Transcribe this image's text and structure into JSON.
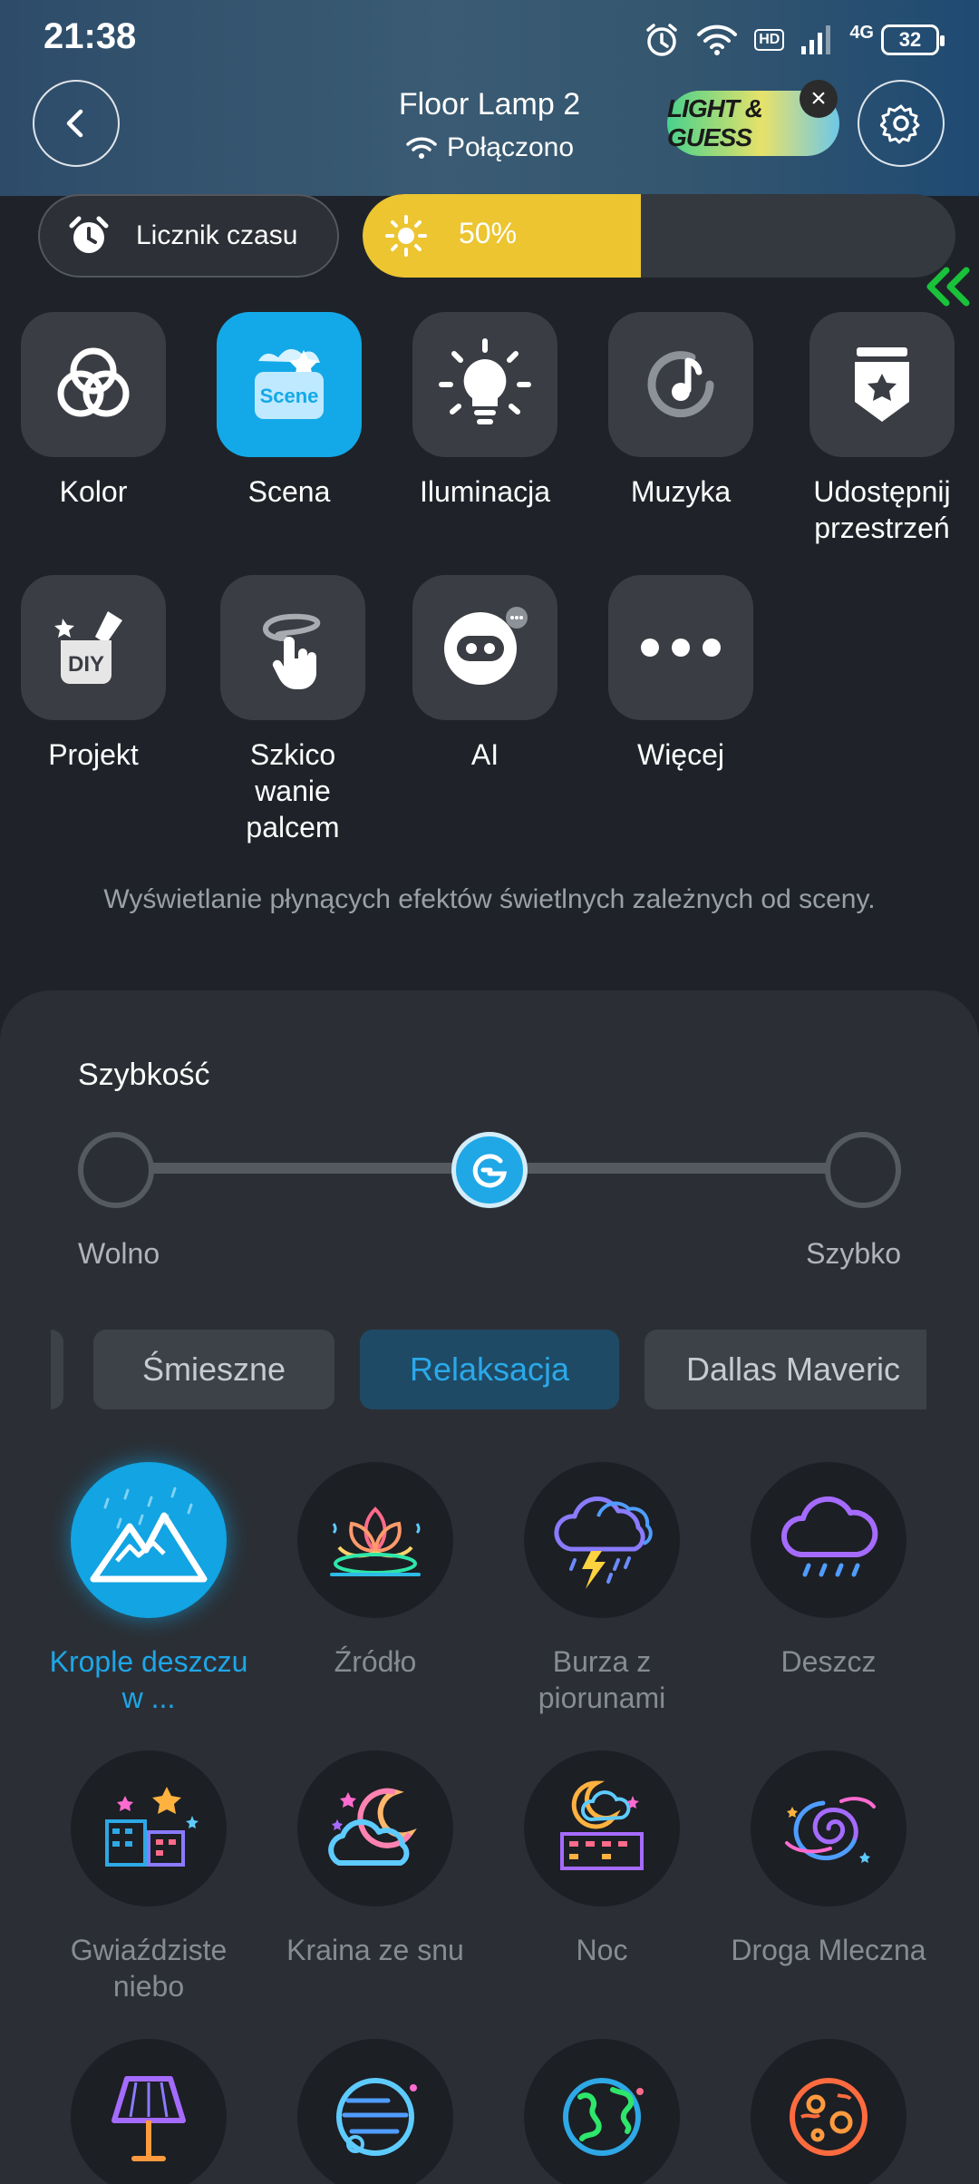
{
  "status_bar": {
    "time": "21:38",
    "hd_label": "HD",
    "network_label": "4G",
    "battery": "32"
  },
  "header": {
    "device_name": "Floor Lamp 2",
    "connection_status": "Połączono",
    "promo_badge": "LIGHT & GUESS",
    "promo_close": "×"
  },
  "controls": {
    "timer_label": "Licznik czasu",
    "brightness_label": "50%",
    "brightness_level": 0.5
  },
  "modes": [
    {
      "label": "Kolor",
      "icon": "color-rings-icon",
      "active": false
    },
    {
      "label": "Scena",
      "icon": "scene-icon",
      "active": true
    },
    {
      "label": "Iluminacja",
      "icon": "bulb-icon",
      "active": false
    },
    {
      "label": "Muzyka",
      "icon": "music-icon",
      "active": false
    },
    {
      "label": "Udostępnij przestrzeń",
      "icon": "share-space-icon",
      "active": false
    },
    {
      "label": "Projekt",
      "icon": "diy-icon",
      "active": false
    },
    {
      "label": "Szkico wanie palcem",
      "icon": "finger-sketch-icon",
      "active": false
    },
    {
      "label": "AI",
      "icon": "ai-robot-icon",
      "active": false
    },
    {
      "label": "Więcej",
      "icon": "more-icon",
      "active": false
    }
  ],
  "scene_tile_text": "Scene",
  "diy_tile_text": "DIY",
  "mode_description": "Wyświetlanie płynących efektów świetlnych zależnych od sceny.",
  "speed": {
    "title": "Szybkość",
    "slow_label": "Wolno",
    "fast_label": "Szybko",
    "level": 0.5
  },
  "categories": [
    {
      "label": "Śmieszne",
      "active": false
    },
    {
      "label": "Relaksacja",
      "active": true
    },
    {
      "label": "Dallas Maveric",
      "active": false
    }
  ],
  "scenes": [
    {
      "label": "Krople deszczu w ...",
      "icon": "mountain-rain-icon",
      "active": true
    },
    {
      "label": "Źródło",
      "icon": "lotus-icon",
      "active": false
    },
    {
      "label": "Burza z piorunami",
      "icon": "thunderstorm-icon",
      "active": false
    },
    {
      "label": "Deszcz",
      "icon": "rain-cloud-icon",
      "active": false
    },
    {
      "label": "Gwiaździste niebo",
      "icon": "starry-city-icon",
      "active": false
    },
    {
      "label": "Kraina ze snu",
      "icon": "dream-moon-icon",
      "active": false
    },
    {
      "label": "Noc",
      "icon": "night-moon-icon",
      "active": false
    },
    {
      "label": "Droga Mleczna",
      "icon": "galaxy-icon",
      "active": false
    },
    {
      "label": "",
      "icon": "lamp-icon",
      "active": false
    },
    {
      "label": "",
      "icon": "jupiter-icon",
      "active": false
    },
    {
      "label": "",
      "icon": "earth-icon",
      "active": false
    },
    {
      "label": "",
      "icon": "mars-icon",
      "active": false
    }
  ],
  "colors": {
    "accent": "#13a9e8",
    "brightness": "#ecc530",
    "background": "#1f2329",
    "sheet": "#2b2f35"
  }
}
